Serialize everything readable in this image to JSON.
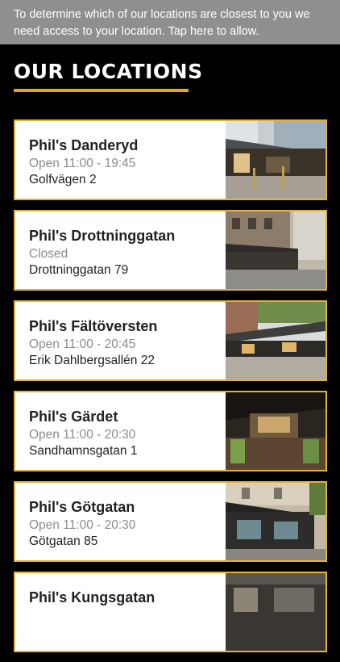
{
  "location_banner": {
    "text": "To determine which of our locations are closest to you we need access to your location. Tap here to allow."
  },
  "page": {
    "title": "OUR LOCATIONS",
    "accent_color": "#e9a31f",
    "card_border_color": "#e3b13a"
  },
  "locations": [
    {
      "name": "Phil's Danderyd",
      "hours": "Open 11:00 - 19:45",
      "address": "Golfvägen 2",
      "photo_icon": "restaurant-terrace-photo"
    },
    {
      "name": "Phil's Drottninggatan",
      "hours": "Closed",
      "address": "Drottninggatan 79",
      "photo_icon": "restaurant-street-photo"
    },
    {
      "name": "Phil's Fältöversten",
      "hours": "Open 11:00 - 20:45",
      "address": "Erik Dahlbergsallén 22",
      "photo_icon": "restaurant-terrace-photo"
    },
    {
      "name": "Phil's Gärdet",
      "hours": "Open 11:00 - 20:30",
      "address": "Sandhamnsgatan 1",
      "photo_icon": "restaurant-interior-photo"
    },
    {
      "name": "Phil's Götgatan",
      "hours": "Open 11:00 - 20:30",
      "address": "Götgatan 85",
      "photo_icon": "restaurant-street-photo"
    },
    {
      "name": "Phil's Kungsgatan",
      "hours": "",
      "address": "",
      "photo_icon": "restaurant-street-photo"
    }
  ]
}
